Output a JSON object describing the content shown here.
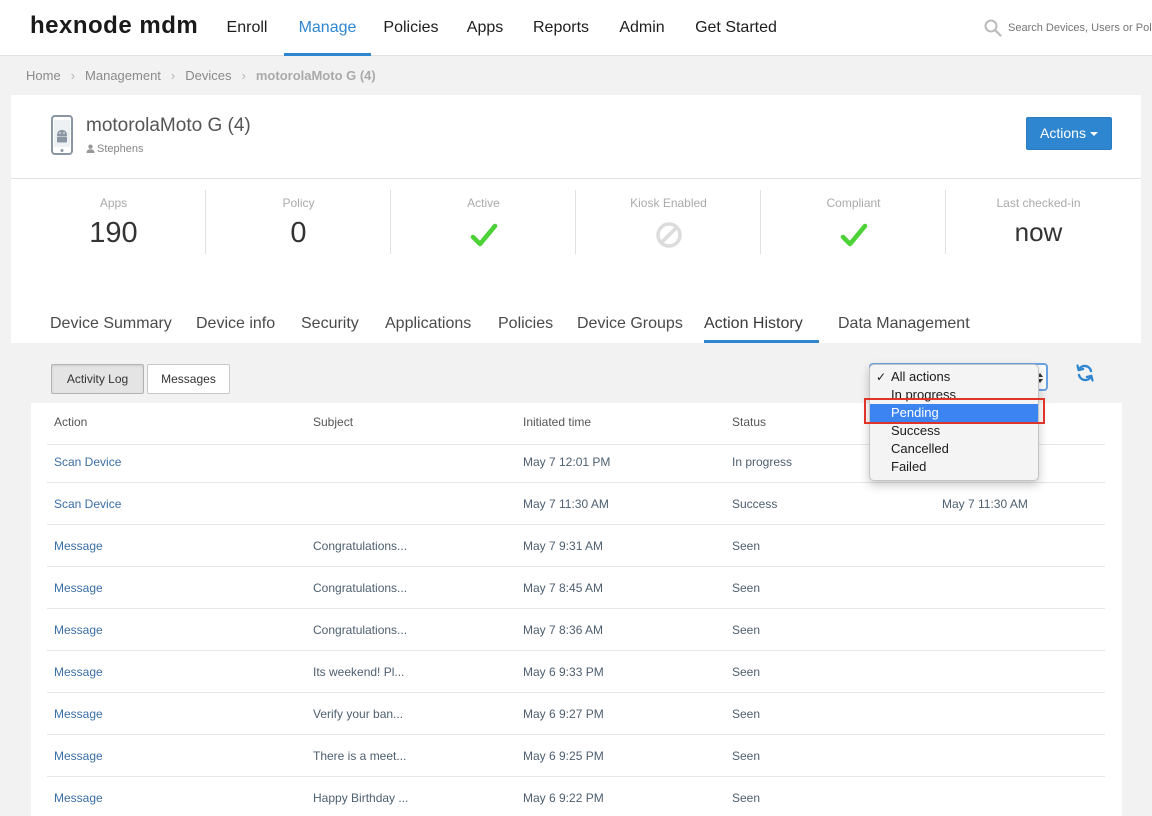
{
  "app": {
    "logo": "hexnode mdm"
  },
  "nav": {
    "items": [
      {
        "label": "Enroll",
        "active": false
      },
      {
        "label": "Manage",
        "active": true
      },
      {
        "label": "Policies",
        "active": false
      },
      {
        "label": "Apps",
        "active": false
      },
      {
        "label": "Reports",
        "active": false
      },
      {
        "label": "Admin",
        "active": false
      },
      {
        "label": "Get Started",
        "active": false
      }
    ],
    "search_placeholder": "Search Devices, Users or Policies"
  },
  "breadcrumb": [
    "Home",
    "Management",
    "Devices",
    "motorolaMoto G (4)"
  ],
  "device": {
    "name": "motorolaMoto G (4)",
    "user": "Stephens",
    "actions_label": "Actions"
  },
  "stats": [
    {
      "label": "Apps",
      "value": "190"
    },
    {
      "label": "Policy",
      "value": "0"
    },
    {
      "label": "Active",
      "icon": "check-icon"
    },
    {
      "label": "Kiosk Enabled",
      "icon": "disabled-icon"
    },
    {
      "label": "Compliant",
      "icon": "check-icon"
    },
    {
      "label": "Last checked-in",
      "value": "now"
    }
  ],
  "tabs": [
    {
      "label": "Device Summary",
      "active": false
    },
    {
      "label": "Device info",
      "active": false
    },
    {
      "label": "Security",
      "active": false
    },
    {
      "label": "Applications",
      "active": false
    },
    {
      "label": "Policies",
      "active": false
    },
    {
      "label": "Device Groups",
      "active": false
    },
    {
      "label": "Action History",
      "active": true
    },
    {
      "label": "Data Management",
      "active": false
    }
  ],
  "toolbar": {
    "activity_log": "Activity Log",
    "messages": "Messages"
  },
  "filter": {
    "options": [
      "All actions",
      "In progress",
      "Pending",
      "Success",
      "Cancelled",
      "Failed"
    ],
    "selected": "All actions",
    "hovered": "Pending"
  },
  "table": {
    "headers": [
      "Action",
      "Subject",
      "Initiated time",
      "Status",
      ""
    ],
    "rows": [
      [
        "Scan Device",
        "",
        "May 7 12:01 PM",
        "In progress",
        ""
      ],
      [
        "Scan Device",
        "",
        "May 7 11:30 AM",
        "Success",
        "May 7 11:30 AM"
      ],
      [
        "Message",
        "Congratulations...",
        "May 7 9:31 AM",
        "Seen",
        ""
      ],
      [
        "Message",
        "Congratulations...",
        "May 7 8:45 AM",
        "Seen",
        ""
      ],
      [
        "Message",
        "Congratulations...",
        "May 7 8:36 AM",
        "Seen",
        ""
      ],
      [
        "Message",
        "Its weekend! Pl...",
        "May 6 9:33 PM",
        "Seen",
        ""
      ],
      [
        "Message",
        "Verify your ban...",
        "May 6 9:27 PM",
        "Seen",
        ""
      ],
      [
        "Message",
        "There is a meet...",
        "May 6 9:25 PM",
        "Seen",
        ""
      ],
      [
        "Message",
        "Happy Birthday ...",
        "May 6 9:22 PM",
        "Seen",
        ""
      ]
    ]
  },
  "colors": {
    "accent": "#2f86d0",
    "check": "#4cd137",
    "highlight": "#e0342b"
  }
}
